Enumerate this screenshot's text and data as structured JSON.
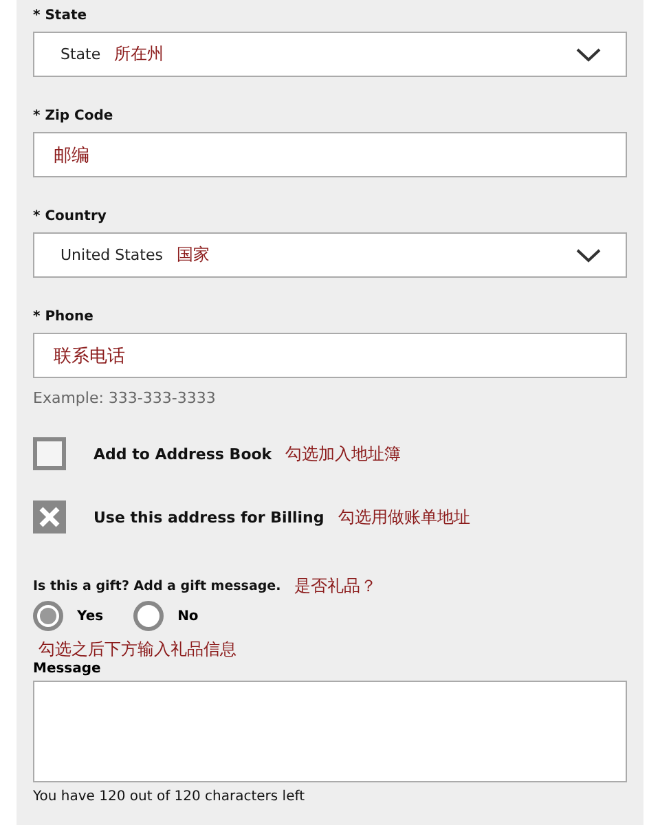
{
  "fields": [
    {
      "kind": "select",
      "label": "* State",
      "value": "State",
      "annotation": "所在州"
    },
    {
      "kind": "text",
      "label": "* Zip Code",
      "annotation": "邮编"
    },
    {
      "kind": "select",
      "label": "* Country",
      "value": "United States",
      "annotation": "国家"
    },
    {
      "kind": "text",
      "label": "* Phone",
      "annotation": "联系电话",
      "hint": "Example: 333-333-3333"
    }
  ],
  "checkboxes": [
    {
      "label": "Add to Address Book",
      "checked": false,
      "annotation": "勾选加入地址簿"
    },
    {
      "label": "Use this address for Billing",
      "checked": true,
      "annotation": "勾选用做账单地址"
    }
  ],
  "gift": {
    "question": "Is this a gift? Add a gift message.",
    "annotation": "是否礼品？",
    "options": [
      {
        "label": "Yes",
        "selected": true
      },
      {
        "label": "No",
        "selected": false
      }
    ],
    "note": "勾选之后下方输入礼品信息",
    "message_label": "Message",
    "counter": "You have 120 out of 120 characters left"
  }
}
